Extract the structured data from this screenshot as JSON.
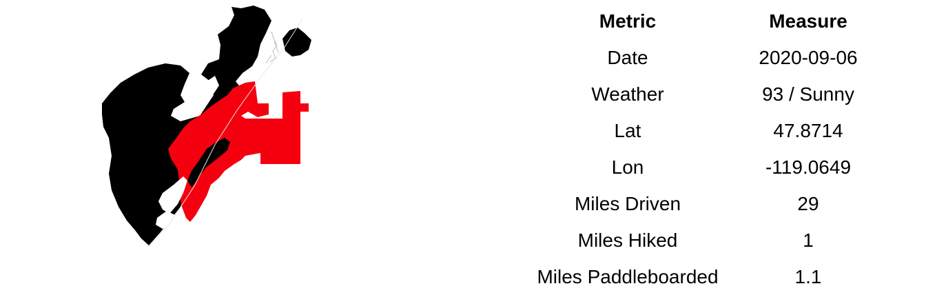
{
  "map": {
    "colors": {
      "land": "#000000",
      "highlight": "#f5000e",
      "water": "#ffffff",
      "trace": "#bbbbbb"
    }
  },
  "table": {
    "headers": [
      "Metric",
      "Measure"
    ],
    "rows": [
      {
        "metric": "Date",
        "measure": "2020-09-06"
      },
      {
        "metric": "Weather",
        "measure": "93 / Sunny"
      },
      {
        "metric": "Lat",
        "measure": "47.8714"
      },
      {
        "metric": "Lon",
        "measure": "-119.0649"
      },
      {
        "metric": "Miles Driven",
        "measure": "29"
      },
      {
        "metric": "Miles Hiked",
        "measure": "1"
      },
      {
        "metric": "Miles Paddleboarded",
        "measure": "1.1"
      }
    ]
  }
}
